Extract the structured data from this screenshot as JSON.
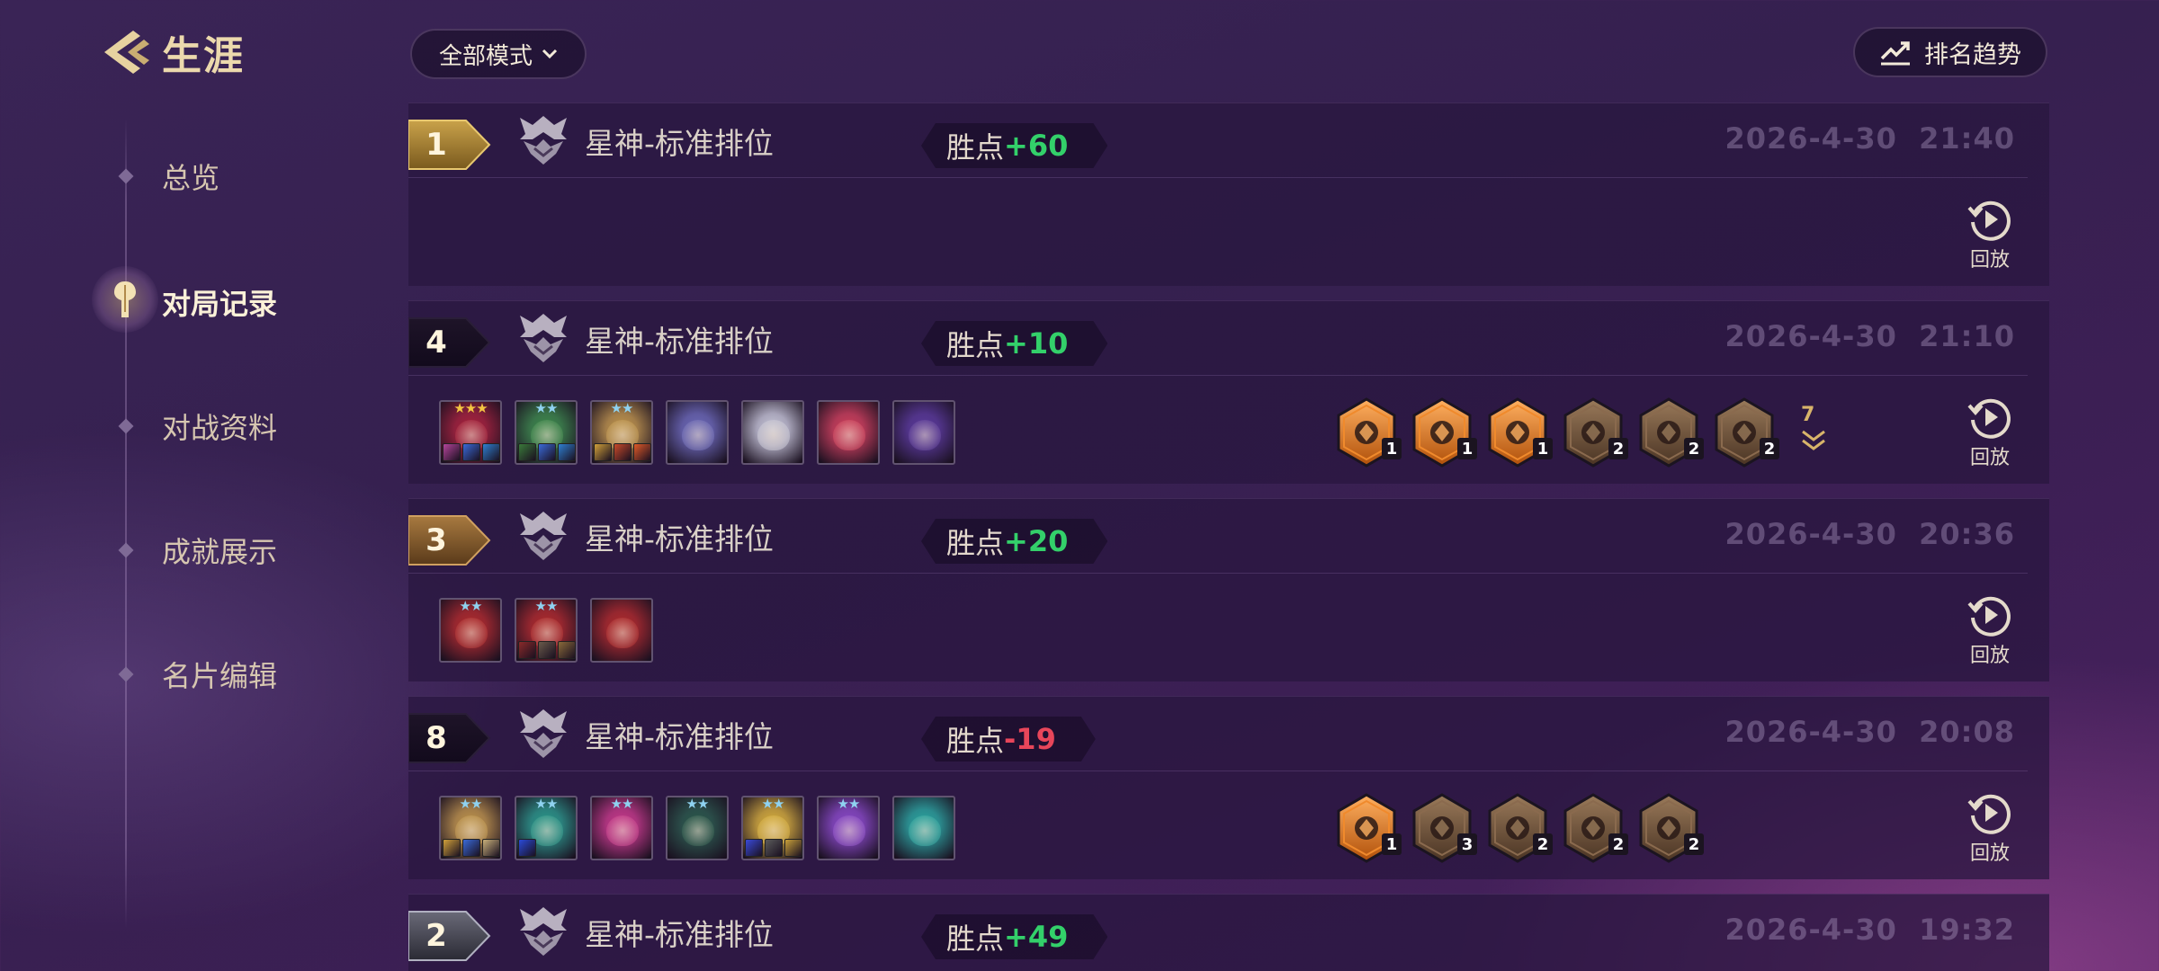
{
  "header": {
    "back_title": "生涯"
  },
  "sidebar": {
    "items": [
      {
        "label": "总览",
        "active": false
      },
      {
        "label": "对局记录",
        "active": true
      },
      {
        "label": "对战资料",
        "active": false
      },
      {
        "label": "成就展示",
        "active": false
      },
      {
        "label": "名片编辑",
        "active": false
      }
    ]
  },
  "toolbar": {
    "mode_filter": "全部模式",
    "trend_label": "排名趋势"
  },
  "colors": {
    "score_positive": "#33d06a",
    "score_negative": "#e8465a",
    "gold_trait": "#f08a2c",
    "bronze_trait": "#8a6a4e"
  },
  "score_prefix": "胜点",
  "replay_label": "回放",
  "matches": [
    {
      "rank": "1",
      "rank_style": "gold",
      "mode": "星神-标准排位",
      "score": "+60",
      "score_sign": "pos",
      "time": "2026-4-30  21:40",
      "expanded": false,
      "units": [],
      "traits": []
    },
    {
      "rank": "4",
      "rank_style": "dark",
      "mode": "星神-标准排位",
      "score": "+10",
      "score_sign": "pos",
      "time": "2026-4-30  21:10",
      "expanded": true,
      "units": [
        {
          "stars": "★★★",
          "star_color": "gold",
          "color": "#a8223a",
          "items": [
            "#b4459a",
            "#3a6ad8",
            "#2f7fd0"
          ]
        },
        {
          "stars": "★★",
          "star_color": "blue",
          "color": "#3c8a4a",
          "items": [
            "#3a7a3a",
            "#3a6ad8",
            "#2f7fd0"
          ]
        },
        {
          "stars": "★★",
          "star_color": "blue",
          "color": "#c0964a",
          "items": [
            "#d0a03a",
            "#c84a2a",
            "#e05a28"
          ]
        },
        {
          "stars": "",
          "star_color": "",
          "color": "#6c6ab8",
          "items": []
        },
        {
          "stars": "",
          "star_color": "",
          "color": "#c8c8d8",
          "items": []
        },
        {
          "stars": "",
          "star_color": "",
          "color": "#d0405a",
          "items": []
        },
        {
          "stars": "",
          "star_color": "",
          "color": "#5a3a9a",
          "items": []
        }
      ],
      "traits": [
        {
          "tier": "gold",
          "count": "1"
        },
        {
          "tier": "gold",
          "count": "1"
        },
        {
          "tier": "gold",
          "count": "1"
        },
        {
          "tier": "bronze",
          "count": "2"
        },
        {
          "tier": "bronze",
          "count": "2"
        },
        {
          "tier": "bronze",
          "count": "2"
        }
      ],
      "more_traits": "7"
    },
    {
      "rank": "3",
      "rank_style": "bronze",
      "mode": "星神-标准排位",
      "score": "+20",
      "score_sign": "pos",
      "time": "2026-4-30  20:36",
      "expanded": true,
      "units": [
        {
          "stars": "★★",
          "star_color": "blue",
          "color": "#b02a2a",
          "items": []
        },
        {
          "stars": "★★",
          "star_color": "blue",
          "color": "#b02a2a",
          "items": [
            "#8a2a2a",
            "#6a5a4a",
            "#8a6a3a"
          ]
        },
        {
          "stars": "",
          "star_color": "",
          "color": "#b02a2a",
          "items": []
        }
      ],
      "traits": [],
      "more_traits": ""
    },
    {
      "rank": "8",
      "rank_style": "dark",
      "mode": "星神-标准排位",
      "score": "-19",
      "score_sign": "neg",
      "time": "2026-4-30  20:08",
      "expanded": true,
      "units": [
        {
          "stars": "★★",
          "star_color": "blue",
          "color": "#c0964a",
          "items": [
            "#d0a03a",
            "#3a6ad8",
            "#c8b07a"
          ]
        },
        {
          "stars": "★★",
          "star_color": "blue",
          "color": "#2a9a8a",
          "items": [
            "#2a4ad8"
          ]
        },
        {
          "stars": "★★",
          "star_color": "blue",
          "color": "#c83a8a",
          "items": []
        },
        {
          "stars": "★★",
          "star_color": "blue",
          "color": "#2a5a4a",
          "items": []
        },
        {
          "stars": "★★",
          "star_color": "blue",
          "color": "#d8b03a",
          "items": [
            "#3a4ad8",
            "#5a5a5a",
            "#c8a03a"
          ]
        },
        {
          "stars": "★★",
          "star_color": "blue",
          "color": "#8a4ac8",
          "items": []
        },
        {
          "stars": "",
          "star_color": "",
          "color": "#2aa8a0",
          "items": []
        }
      ],
      "traits": [
        {
          "tier": "gold",
          "count": "1"
        },
        {
          "tier": "bronze",
          "count": "3"
        },
        {
          "tier": "bronze",
          "count": "2"
        },
        {
          "tier": "bronze",
          "count": "2"
        },
        {
          "tier": "bronze",
          "count": "2"
        }
      ],
      "more_traits": ""
    },
    {
      "rank": "2",
      "rank_style": "silver",
      "mode": "星神-标准排位",
      "score": "+49",
      "score_sign": "pos",
      "time": "2026-4-30  19:32",
      "expanded": false,
      "units": [],
      "traits": []
    }
  ]
}
